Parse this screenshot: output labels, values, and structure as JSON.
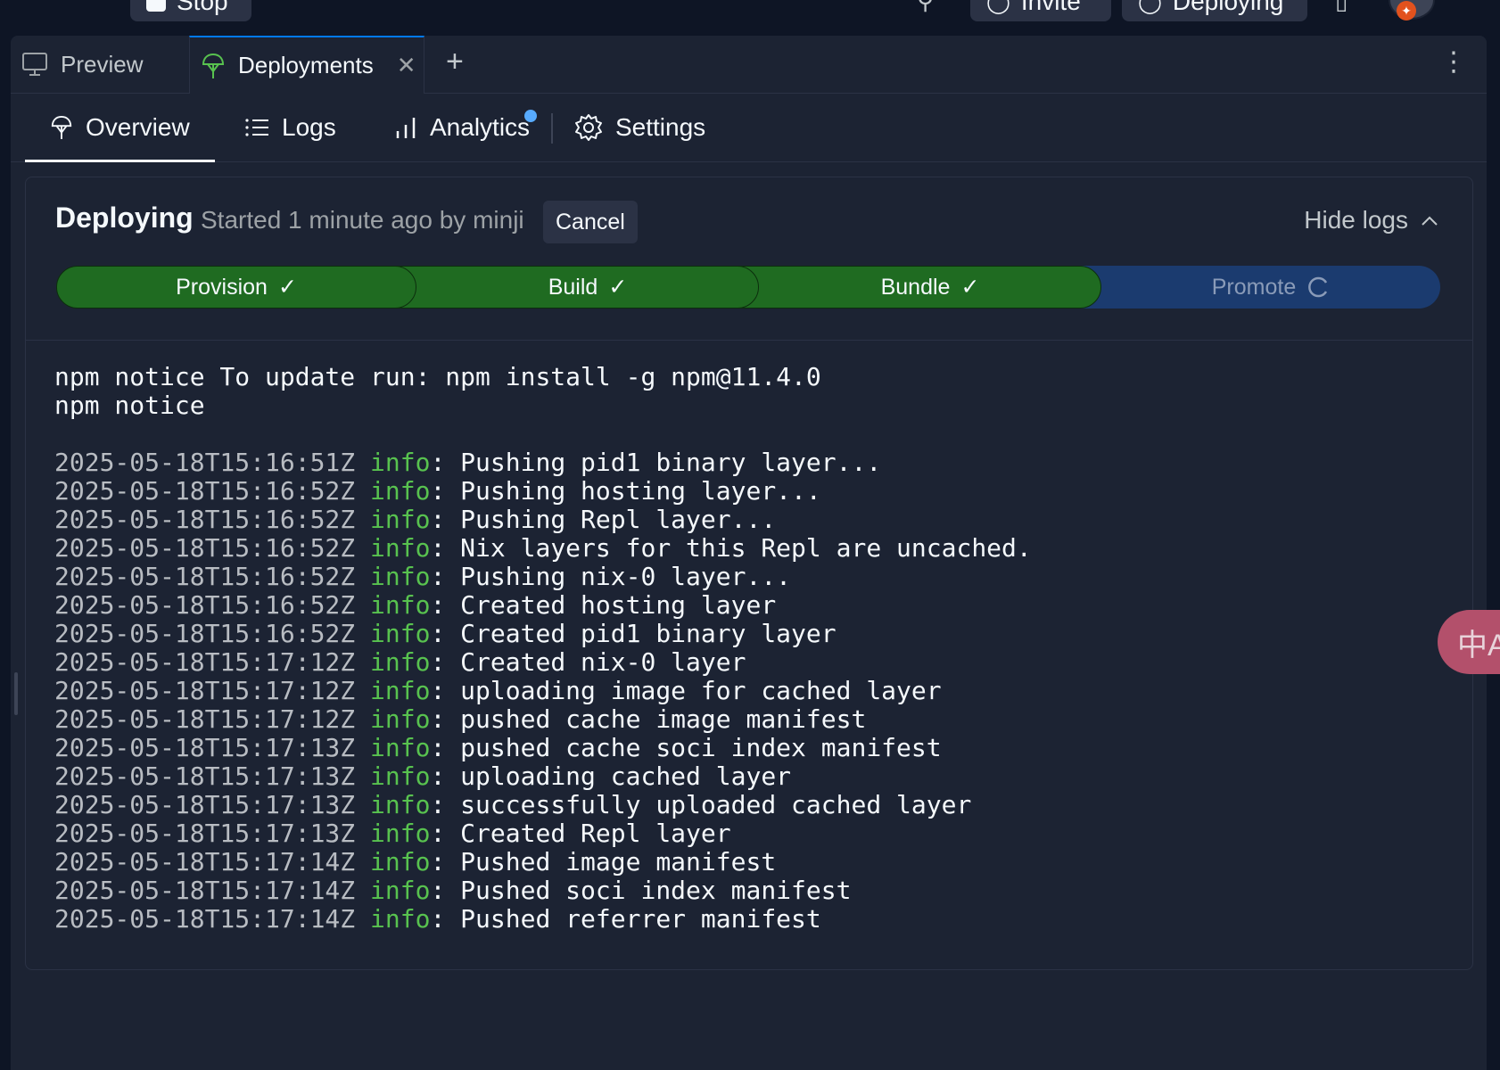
{
  "topbar": {
    "stop_label": "Stop",
    "invite_label": "Invite",
    "deploying_label": "Deploying"
  },
  "tabs": [
    {
      "label": "Preview",
      "icon": "monitor-icon",
      "active": false
    },
    {
      "label": "Deployments",
      "icon": "deployments-icon",
      "active": true
    }
  ],
  "subnav": {
    "overview": "Overview",
    "logs": "Logs",
    "analytics": "Analytics",
    "settings": "Settings"
  },
  "deployment": {
    "status": "Deploying",
    "subtitle": "Started 1 minute ago by minji",
    "cancel_label": "Cancel",
    "hide_logs_label": "Hide logs",
    "steps": [
      {
        "label": "Provision",
        "state": "done"
      },
      {
        "label": "Build",
        "state": "done"
      },
      {
        "label": "Bundle",
        "state": "done"
      },
      {
        "label": "Promote",
        "state": "in-progress"
      }
    ]
  },
  "logs": {
    "preamble": [
      "npm notice To update run: npm install -g npm@11.4.0",
      "npm notice",
      ""
    ],
    "entries": [
      {
        "ts": "2025-05-18T15:16:51Z",
        "level": "info",
        "msg": ": Pushing pid1 binary layer..."
      },
      {
        "ts": "2025-05-18T15:16:52Z",
        "level": "info",
        "msg": ": Pushing hosting layer..."
      },
      {
        "ts": "2025-05-18T15:16:52Z",
        "level": "info",
        "msg": ": Pushing Repl layer..."
      },
      {
        "ts": "2025-05-18T15:16:52Z",
        "level": "info",
        "msg": ": Nix layers for this Repl are uncached."
      },
      {
        "ts": "2025-05-18T15:16:52Z",
        "level": "info",
        "msg": ": Pushing nix-0 layer..."
      },
      {
        "ts": "2025-05-18T15:16:52Z",
        "level": "info",
        "msg": ": Created hosting layer"
      },
      {
        "ts": "2025-05-18T15:16:52Z",
        "level": "info",
        "msg": ": Created pid1 binary layer"
      },
      {
        "ts": "2025-05-18T15:17:12Z",
        "level": "info",
        "msg": ": Created nix-0 layer"
      },
      {
        "ts": "2025-05-18T15:17:12Z",
        "level": "info",
        "msg": ": uploading image for cached layer"
      },
      {
        "ts": "2025-05-18T15:17:12Z",
        "level": "info",
        "msg": ": pushed cache image manifest"
      },
      {
        "ts": "2025-05-18T15:17:13Z",
        "level": "info",
        "msg": ": pushed cache soci index manifest"
      },
      {
        "ts": "2025-05-18T15:17:13Z",
        "level": "info",
        "msg": ": uploading cached layer"
      },
      {
        "ts": "2025-05-18T15:17:13Z",
        "level": "info",
        "msg": ": successfully uploaded cached layer"
      },
      {
        "ts": "2025-05-18T15:17:13Z",
        "level": "info",
        "msg": ": Created Repl layer"
      },
      {
        "ts": "2025-05-18T15:17:14Z",
        "level": "info",
        "msg": ": Pushed image manifest"
      },
      {
        "ts": "2025-05-18T15:17:14Z",
        "level": "info",
        "msg": ": Pushed soci index manifest"
      },
      {
        "ts": "2025-05-18T15:17:14Z",
        "level": "info",
        "msg": ": Pushed referrer manifest"
      }
    ]
  },
  "translate_icon": "translate-icon"
}
